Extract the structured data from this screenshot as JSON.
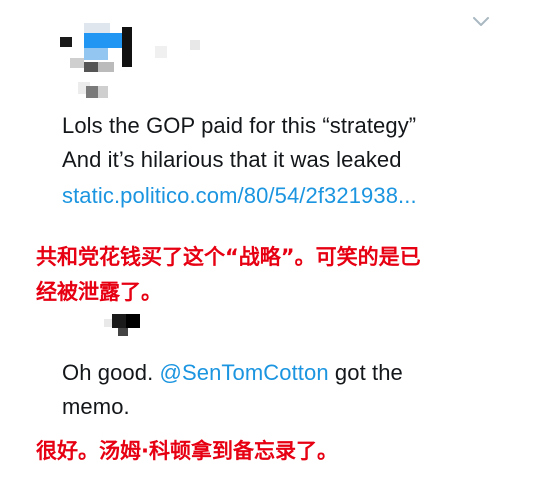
{
  "colors": {
    "text": "#14171a",
    "link": "#1b95e0",
    "translation": "#e60012",
    "icon": "#aab8c2"
  },
  "tweet1": {
    "line1": "Lols the GOP paid for this “strategy”",
    "line2": "And it’s hilarious that it was leaked",
    "link": "static.politico.com/80/54/2f321938..."
  },
  "translation1": "共和党花钱买了这个“战略”。可笑的是已\n经被泄露了。",
  "tweet2": {
    "text_before": "Oh good. ",
    "mention": "@SenTomCotton",
    "text_after": " got the",
    "line2": "memo."
  },
  "translation2": "很好。汤姆·科顿拿到备忘录了。",
  "icons": {
    "menu": "chevron-down-icon",
    "avatar1": "avatar",
    "avatar2": "avatar"
  }
}
